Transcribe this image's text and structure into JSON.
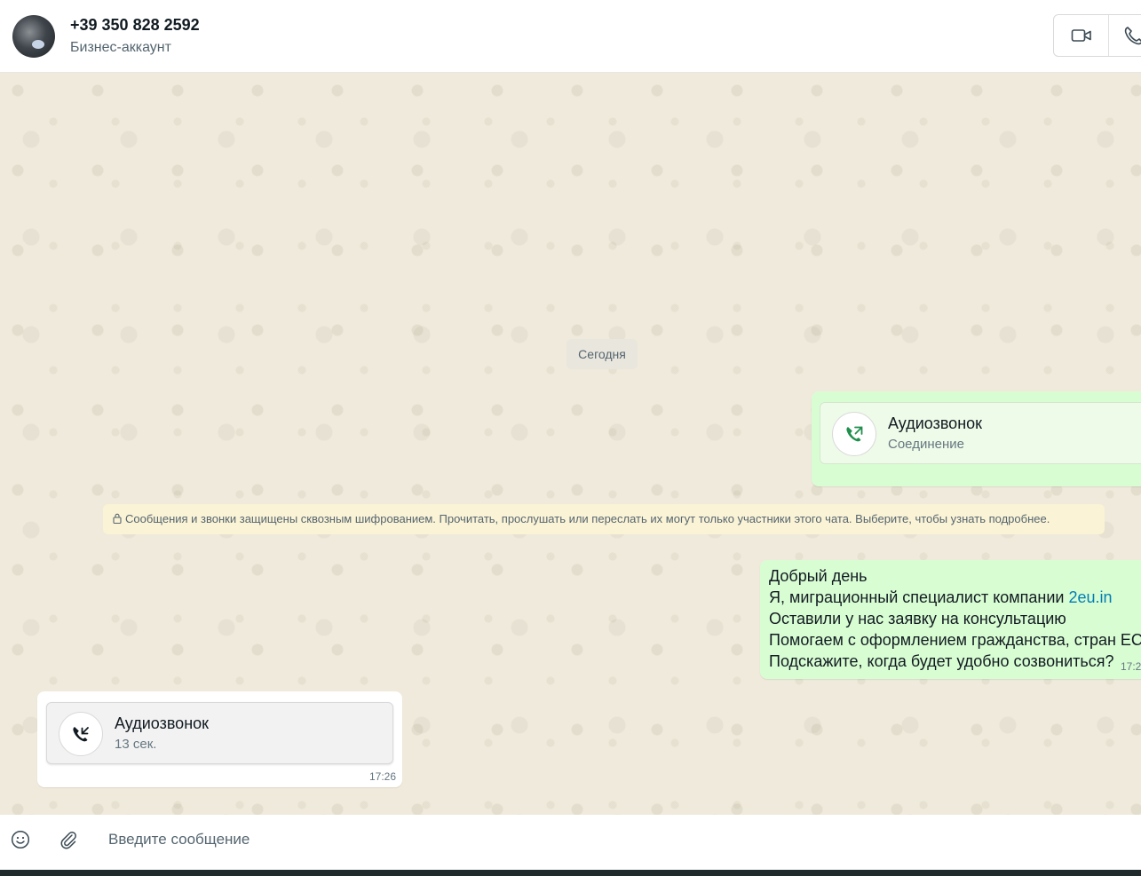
{
  "header": {
    "contact_name": "+39 350 828 2592",
    "contact_subtitle": "Бизнес-аккаунт"
  },
  "icons": {
    "video": "video-camera-icon",
    "voice": "phone-icon",
    "emoji": "emoji-icon",
    "attach": "paperclip-icon",
    "lock": "lock-icon"
  },
  "chat": {
    "date_chip": "Сегодня",
    "outgoing_call": {
      "title": "Аудиозвонок",
      "status": "Соединение"
    },
    "encryption_notice": "Сообщения и звонки защищены сквозным шифрованием. Прочитать, прослушать или переслать их могут только участники этого чата. Выберите, чтобы узнать подробнее.",
    "outgoing_message": {
      "line1": "Добрый день",
      "line2_text": "Я, миграционный специалист компании ",
      "line2_link": "2eu.in",
      "line3": "Оставили у нас заявку на консультацию",
      "line4": "Помогаем с оформлением гражданства, стран ЕС",
      "line5": "Подскажите, когда будет удобно созвониться?",
      "time": "17:2"
    },
    "incoming_call": {
      "title": "Аудиозвонок",
      "duration": "13 сек.",
      "time": "17:26"
    }
  },
  "composer": {
    "placeholder": "Введите сообщение"
  },
  "colors": {
    "outgoing_bubble": "#d9fdd3",
    "incoming_bubble": "#ffffff",
    "call_icon_green": "#1f8f4c",
    "link": "#027eb5"
  }
}
